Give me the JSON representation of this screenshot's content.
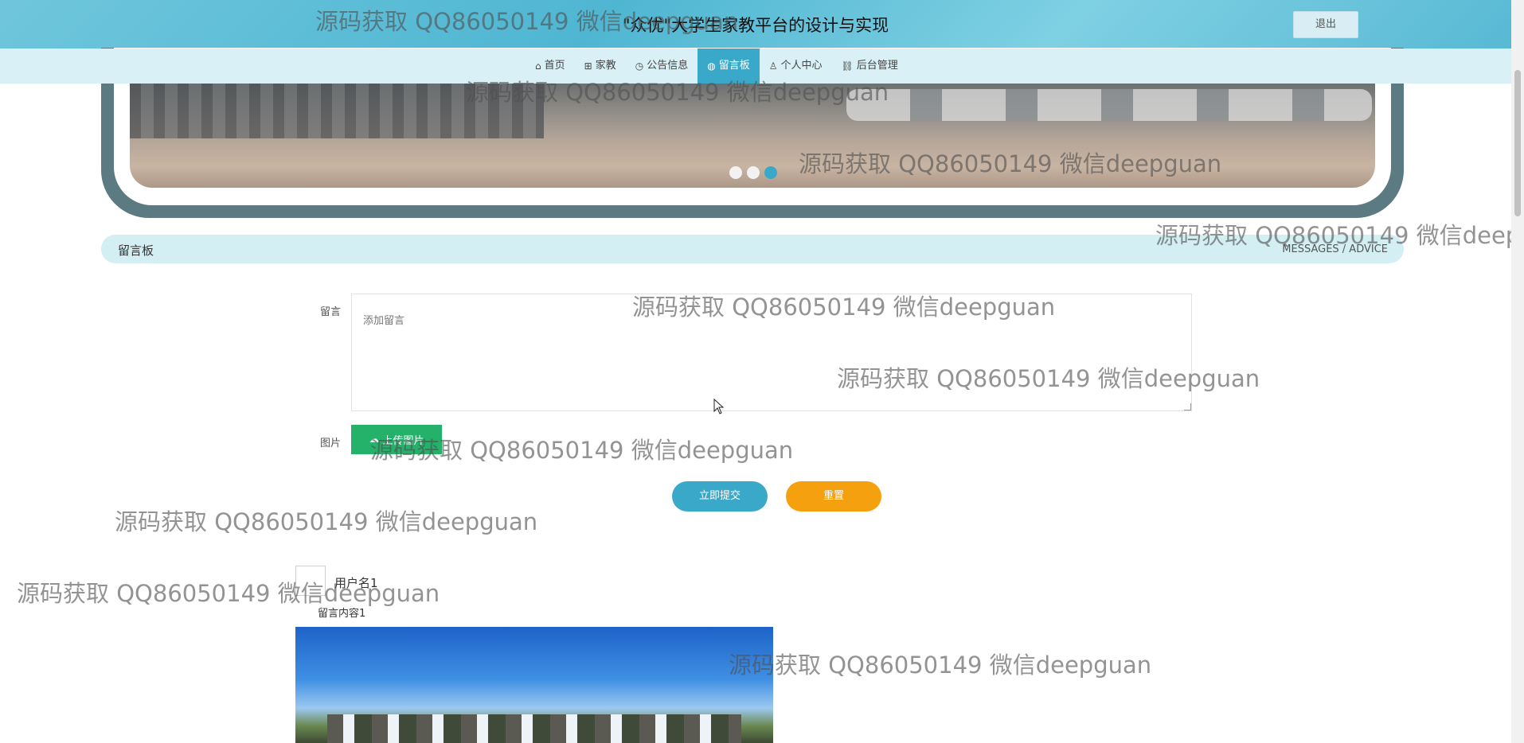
{
  "header": {
    "title": "\"众优\"大学生家教平台的设计与实现",
    "logout_label": "退出"
  },
  "nav": {
    "items": [
      {
        "label": "首页",
        "icon": "home-icon",
        "glyph": "⌂"
      },
      {
        "label": "家教",
        "icon": "gift-icon",
        "glyph": "🎁"
      },
      {
        "label": "公告信息",
        "icon": "clock-icon",
        "glyph": "◷"
      },
      {
        "label": "留言板",
        "icon": "globe-icon",
        "glyph": "◍"
      },
      {
        "label": "个人中心",
        "icon": "user-icon",
        "glyph": "♙"
      },
      {
        "label": "后台管理",
        "icon": "link-icon",
        "glyph": "⛓"
      }
    ],
    "active_index": 3
  },
  "banner": {
    "slide_count": 3,
    "active_slide": 3
  },
  "section": {
    "title": "留言板",
    "subtitle": "MESSAGES / ADVICE"
  },
  "form": {
    "message_label": "留言",
    "message_placeholder": "添加留言",
    "image_label": "图片",
    "upload_label": "上传图片",
    "submit_label": "立即提交",
    "reset_label": "重置"
  },
  "messages": [
    {
      "username": "用户名1",
      "content": "留言内容1"
    }
  ],
  "watermark": {
    "text": "源码获取 QQ86050149 微信deepguan",
    "truncated_text": "源码获取 QQ86050149 微信deep"
  },
  "colors": {
    "accent": "#3aa9c9",
    "upload": "#24b26b",
    "reset": "#f5a10f",
    "nav_bg": "#d9f1f6",
    "section_bg": "#d3eff4"
  }
}
